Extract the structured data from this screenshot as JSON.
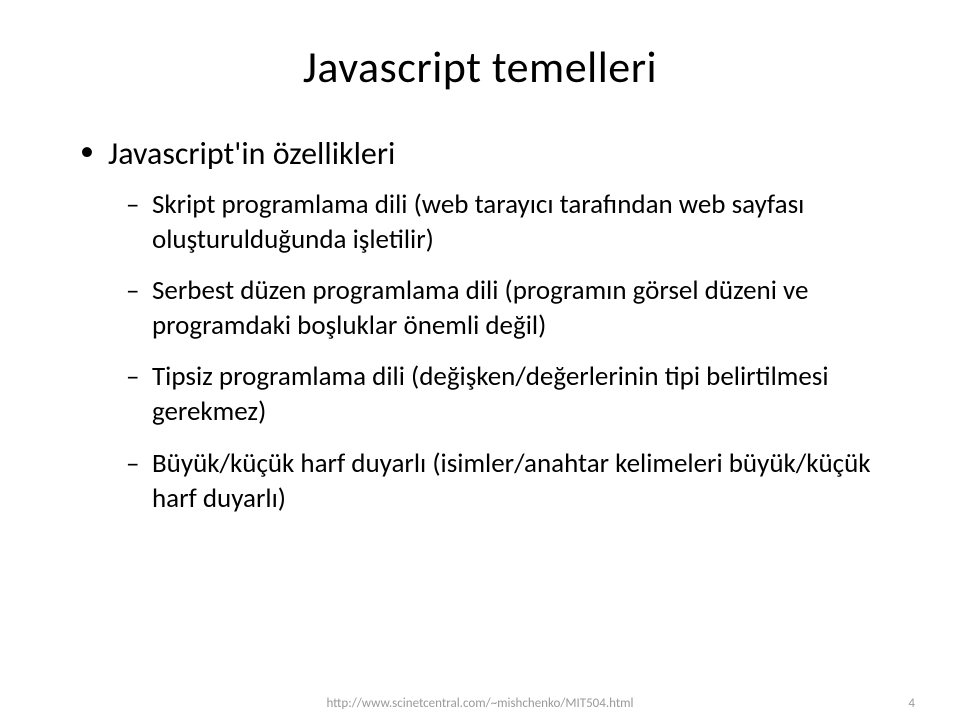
{
  "slide": {
    "title": "Javascript temelleri",
    "bullet": {
      "text": "Javascript'in özellikleri",
      "subitems": [
        "Skript programlama dili (web tarayıcı tarafından web sayfası oluşturulduğunda işletilir)",
        "Serbest düzen programlama dili (programın görsel düzeni ve programdaki boşluklar önemli değil)",
        "Tipsiz programlama dili (değişken/değerlerinin tipi belirtilmesi gerekmez)",
        "Büyük/küçük harf duyarlı (isimler/anahtar kelimeleri büyük/küçük harf duyarlı)"
      ]
    },
    "footer": {
      "url": "http://www.scinetcentral.com/~mishchenko/MIT504.html",
      "page": "4"
    }
  }
}
